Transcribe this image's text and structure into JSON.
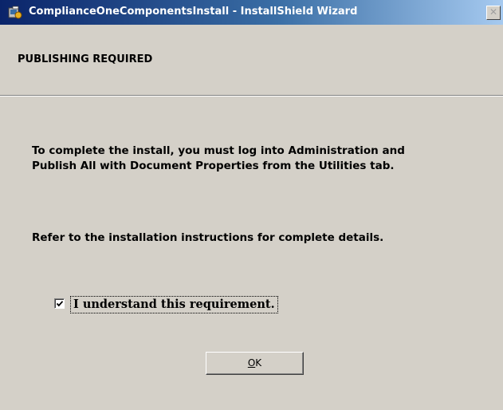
{
  "window": {
    "title": "ComplianceOneComponentsInstall - InstallShield Wizard",
    "close_glyph": "✕"
  },
  "header": {
    "title": "PUBLISHING REQUIRED"
  },
  "body": {
    "message_line1": "To complete the install, you must log into Administration and",
    "message_line2": "Publish All with Document Properties from the Utilities tab.",
    "message2": "Refer to the installation instructions for complete details."
  },
  "checkbox": {
    "label": "I understand this requirement.",
    "checked": true
  },
  "buttons": {
    "ok_mnemonic": "O",
    "ok_rest": "K"
  },
  "icons": {
    "app": "installshield-icon",
    "close": "close-icon",
    "check": "checkmark-icon"
  },
  "colors": {
    "titlebar_start": "#0a246a",
    "titlebar_end": "#a6caf0",
    "dialog_bg": "#d4d0c8"
  }
}
